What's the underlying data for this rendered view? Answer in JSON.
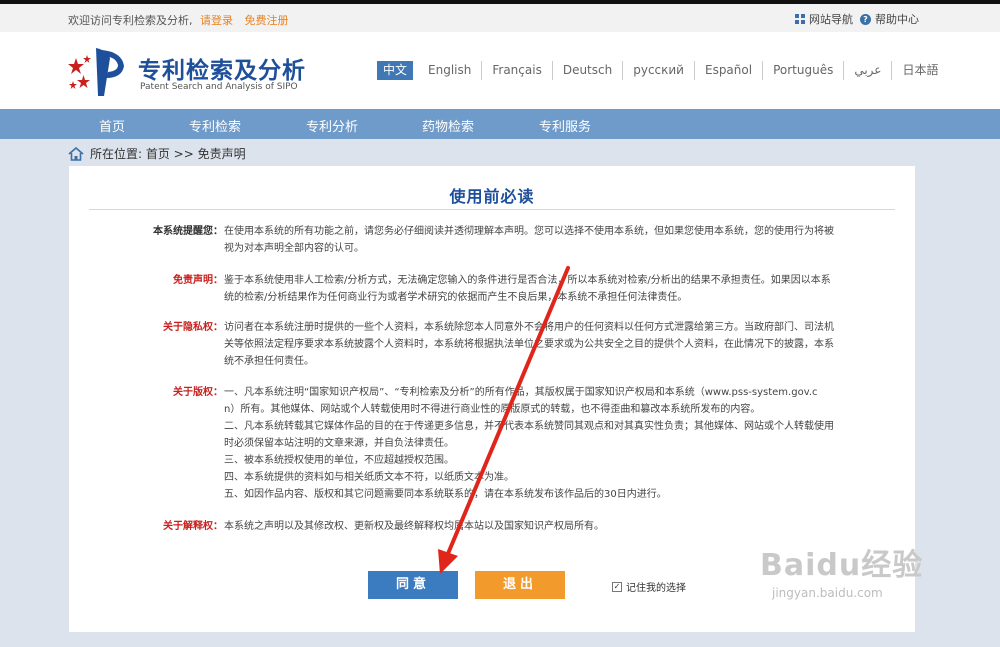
{
  "topbar": {
    "welcome": "欢迎访问专利检索及分析,",
    "login": "请登录",
    "register": "免费注册",
    "sitemap": "网站导航",
    "help": "帮助中心"
  },
  "header": {
    "title": "专利检索及分析",
    "subtitle": "Patent Search and Analysis of SIPO"
  },
  "languages": [
    "中文",
    "English",
    "Français",
    "Deutsch",
    "русский",
    "Español",
    "Português",
    "عربي",
    "日本語"
  ],
  "nav": [
    "首页",
    "专利检索",
    "专利分析",
    "药物检索",
    "专利服务"
  ],
  "breadcrumb": "所在位置: 首页 >> 免责声明",
  "panel": {
    "title": "使用前必读",
    "sections": [
      {
        "label": "本系统提醒您：",
        "lines": [
          "在使用本系统的所有功能之前，请您务必仔细阅读并透彻理解本声明。您可以选择不使用本系统，但如果您使用本系统，您的使用行为将被",
          "视为对本声明全部内容的认可。"
        ]
      },
      {
        "label": "免责声明：",
        "lines": [
          "鉴于本系统使用非人工检索/分析方式，无法确定您输入的条件进行是否合法，所以本系统对检索/分析出的结果不承担责任。如果因以本系",
          "统的检索/分析结果作为任何商业行为或者学术研究的依据而产生不良后果，本系统不承担任何法律责任。"
        ]
      },
      {
        "label": "关于隐私权：",
        "lines": [
          "访问者在本系统注册时提供的一些个人资料，本系统除您本人同意外不会将用户的任何资料以任何方式泄露给第三方。当政府部门、司法机",
          "关等依照法定程序要求本系统披露个人资料时，本系统将根据执法单位之要求或为公共安全之目的提供个人资料，在此情况下的披露，本系",
          "统不承担任何责任。"
        ]
      },
      {
        "label": "关于版权：",
        "lines": [
          "一、凡本系统注明“国家知识产权局”、“专利检索及分析”的所有作品，其版权属于国家知识产权局和本系统（www.pss-system.gov.c",
          "n）所有。其他媒体、网站或个人转载使用时不得进行商业性的原版原式的转载，也不得歪曲和篡改本系统所发布的内容。",
          "二、凡本系统转载其它媒体作品的目的在于传递更多信息，并不代表本系统赞同其观点和对其真实性负责；其他媒体、网站或个人转载使用",
          "时必须保留本站注明的文章来源，并自负法律责任。",
          "三、被本系统授权使用的单位，不应超越授权范围。",
          "四、本系统提供的资料如与相关纸质文本不符，以纸质文本为准。",
          "五、如因作品内容、版权和其它问题需要同本系统联系的，请在本系统发布该作品后的30日内进行。"
        ]
      },
      {
        "label": "关于解释权：",
        "lines": [
          "本系统之声明以及其修改权、更新权及最终解释权均属本站以及国家知识产权局所有。"
        ]
      }
    ],
    "agree": "同意",
    "exit": "退出",
    "remember": "记住我的选择"
  },
  "watermark": {
    "brand": "Baidu经验",
    "url": "jingyan.baidu.com"
  },
  "colors": {
    "nav": "#6e9bc9",
    "title": "#1d4f9a",
    "agree": "#3b7bc0",
    "exit": "#f39a2c",
    "red_label": "#c8211e",
    "arrow": "#e0251b"
  }
}
